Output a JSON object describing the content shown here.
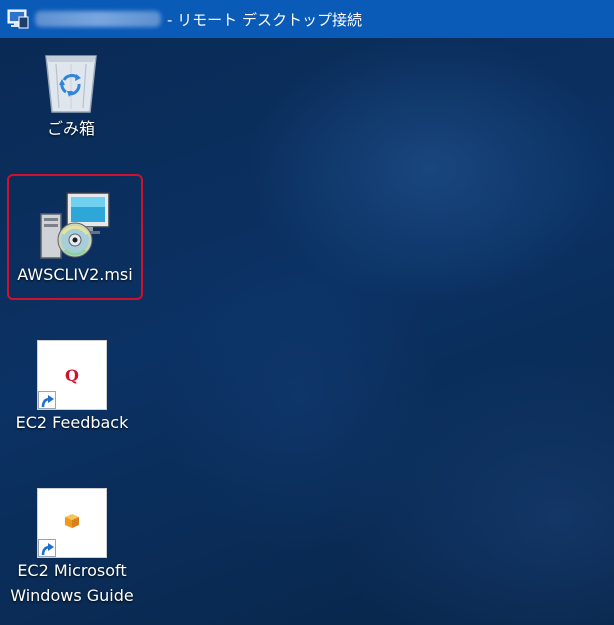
{
  "titlebar": {
    "title": "- リモート デスクトップ接続",
    "host_redacted": true,
    "background": "#0a5ab8"
  },
  "desktop": {
    "icons": [
      {
        "label": "ごみ箱",
        "icon": "recycle-bin-icon"
      },
      {
        "label": "AWSCLIV2.msi",
        "icon": "msi-installer-icon",
        "selected": true,
        "highlight_color": "#d0112b"
      },
      {
        "label": "EC2 Feedback",
        "icon": "ec2-feedback-shortcut-icon",
        "glyph": "Q"
      },
      {
        "label_lines": [
          "EC2 Microsoft",
          "Windows Guide"
        ],
        "icon": "ec2-guide-shortcut-icon"
      }
    ]
  }
}
